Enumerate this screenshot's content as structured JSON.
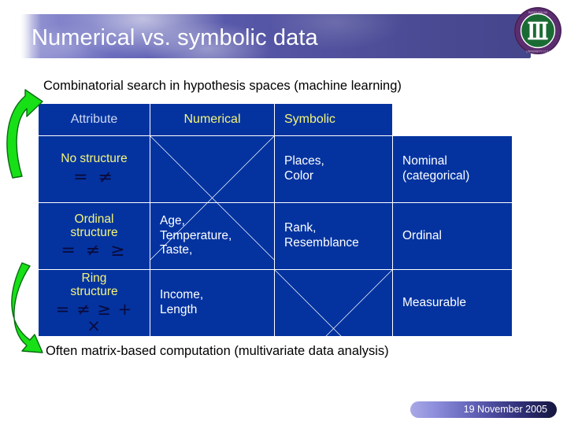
{
  "slide": {
    "title": "Numerical vs. symbolic data",
    "subtitle": "Combinatorial search in hypothesis spaces (machine learning)",
    "footnote": "Often matrix-based computation (multivariate data analysis)",
    "date": "19 November 2005"
  },
  "logo": {
    "name": "university-seal-logo",
    "ring_text": "BABEȘ-BOLYAI UNIVERSITY",
    "colors": {
      "ring": "#5b2d6e",
      "disc": "#1a6b33",
      "columns": "#ffffff"
    }
  },
  "colors": {
    "banner_start": "#8e8fd0",
    "banner_end": "#45458c",
    "table_cell": "#0433A0",
    "header_attribute": "#cfd7f2",
    "header_yellow": "#f6f57a",
    "struct_label": "#f6f57a",
    "operator": "#0a0a3c",
    "cell_text": "#ffffff",
    "arrow_green": "#17e017",
    "grid_line": "#ffffff"
  },
  "table": {
    "name": "numerical-vs-symbolic-table",
    "headers": [
      "Attribute",
      "Numerical",
      "Symbolic",
      ""
    ],
    "rows": [
      {
        "structure": "No structure",
        "operators": "= ≠",
        "numerical": "",
        "numerical_crossed": true,
        "symbolic": "Places,\nColor",
        "symbolic_line1": "Places,",
        "symbolic_line2": "Color",
        "scale": "Nominal\n(categorical)",
        "scale_line1": "Nominal",
        "scale_line2": "(categorical)",
        "scale_crossed": false
      },
      {
        "structure": "Ordinal\nstructure",
        "structure_line1": "Ordinal",
        "structure_line2": "structure",
        "operators": "= ≠ ≥",
        "numerical": "Age,\nTemperature,\nTaste,",
        "numerical_line1": "Age,",
        "numerical_line2": "Temperature,",
        "numerical_line3": "Taste,",
        "numerical_crossed": false,
        "symbolic_line1": "Rank,",
        "symbolic_line2": "Resemblance",
        "scale_line1": "Ordinal",
        "scale_line2": "",
        "scale_crossed": false
      },
      {
        "structure": "Ring\nstructure",
        "structure_line1": "Ring",
        "structure_line2": "structure",
        "operators": "= ≠ ≥ + ×",
        "numerical_line1": "Income,",
        "numerical_line2": "Length",
        "numerical_crossed": false,
        "symbolic_line1": "",
        "symbolic_line2": "",
        "symbolic_crossed": true,
        "scale_line1": "Measurable",
        "scale_line2": "",
        "scale_crossed": false
      }
    ]
  },
  "arrows": [
    {
      "name": "arrow-up-curved",
      "direction": "up"
    },
    {
      "name": "arrow-down-curved",
      "direction": "down"
    }
  ]
}
